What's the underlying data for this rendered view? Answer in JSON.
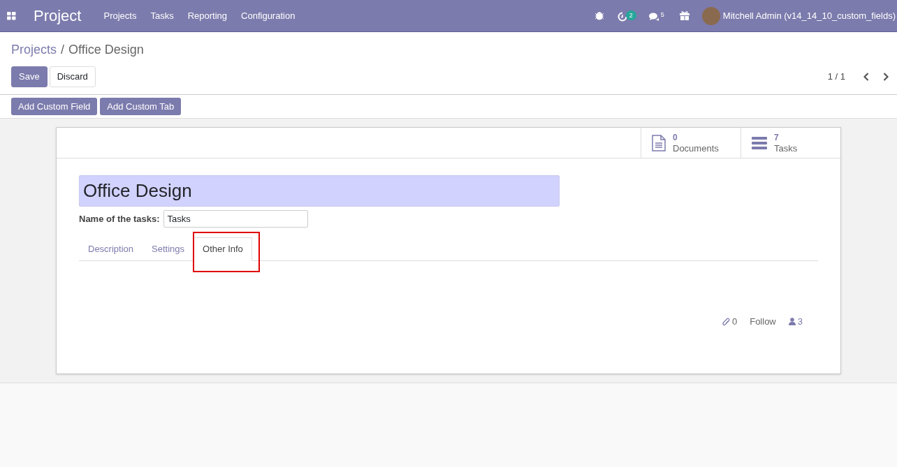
{
  "navbar": {
    "app_title": "Project",
    "menu": [
      "Projects",
      "Tasks",
      "Reporting",
      "Configuration"
    ],
    "activity_count": "2",
    "message_count": "5",
    "user": "Mitchell Admin (v14_14_10_custom_fields)"
  },
  "breadcrumb": [
    {
      "label": "Projects",
      "kind": "link"
    },
    {
      "label": "/",
      "kind": "separator"
    },
    {
      "label": "Office Design",
      "kind": "current"
    }
  ],
  "buttons": [
    {
      "label": "Save",
      "kind": "primary"
    },
    {
      "label": "Discard",
      "kind": "secondary"
    }
  ],
  "pager": "1 / 1",
  "custom_buttons": [
    "Add Custom Field",
    "Add Custom Tab"
  ],
  "smart_buttons": [
    {
      "count": "0",
      "label": "Documents",
      "kind": "document"
    },
    {
      "count": "7",
      "label": "Tasks",
      "kind": "tasks"
    }
  ],
  "form": {
    "name": "Office Design",
    "field_label": "Name of the tasks:",
    "field_value": "Tasks"
  },
  "tabs": [
    {
      "label": "Description",
      "selected": false,
      "highlighted": false
    },
    {
      "label": "Settings",
      "selected": false,
      "highlighted": false
    },
    {
      "label": "Other Info",
      "selected": true,
      "highlighted": true
    }
  ],
  "chatter": {
    "attachments": "0",
    "follow": "Follow",
    "followers": "3"
  }
}
